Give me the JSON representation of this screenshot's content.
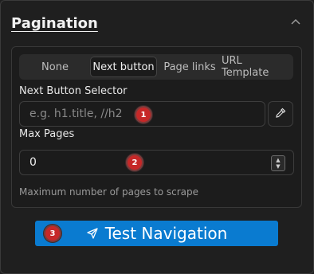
{
  "section": {
    "title": "Pagination",
    "collapse_icon": "chevron-up-icon"
  },
  "tabs": [
    {
      "label": "None",
      "active": false
    },
    {
      "label": "Next button",
      "active": true
    },
    {
      "label": "Page links",
      "active": false
    },
    {
      "label": "URL Template",
      "active": false
    }
  ],
  "next_button_selector": {
    "label": "Next Button Selector",
    "placeholder": "e.g. h1.title, //h2",
    "value": "",
    "picker_icon": "eyedropper-icon"
  },
  "max_pages": {
    "label": "Max Pages",
    "value": "0",
    "helper": "Maximum number of pages to scrape"
  },
  "test_button": {
    "label": "Test Navigation",
    "icon": "send-icon"
  },
  "markers": [
    "1",
    "2",
    "3"
  ],
  "colors": {
    "accent": "#0a7bd0",
    "marker": "#c62828",
    "background": "#1f1f1f"
  }
}
